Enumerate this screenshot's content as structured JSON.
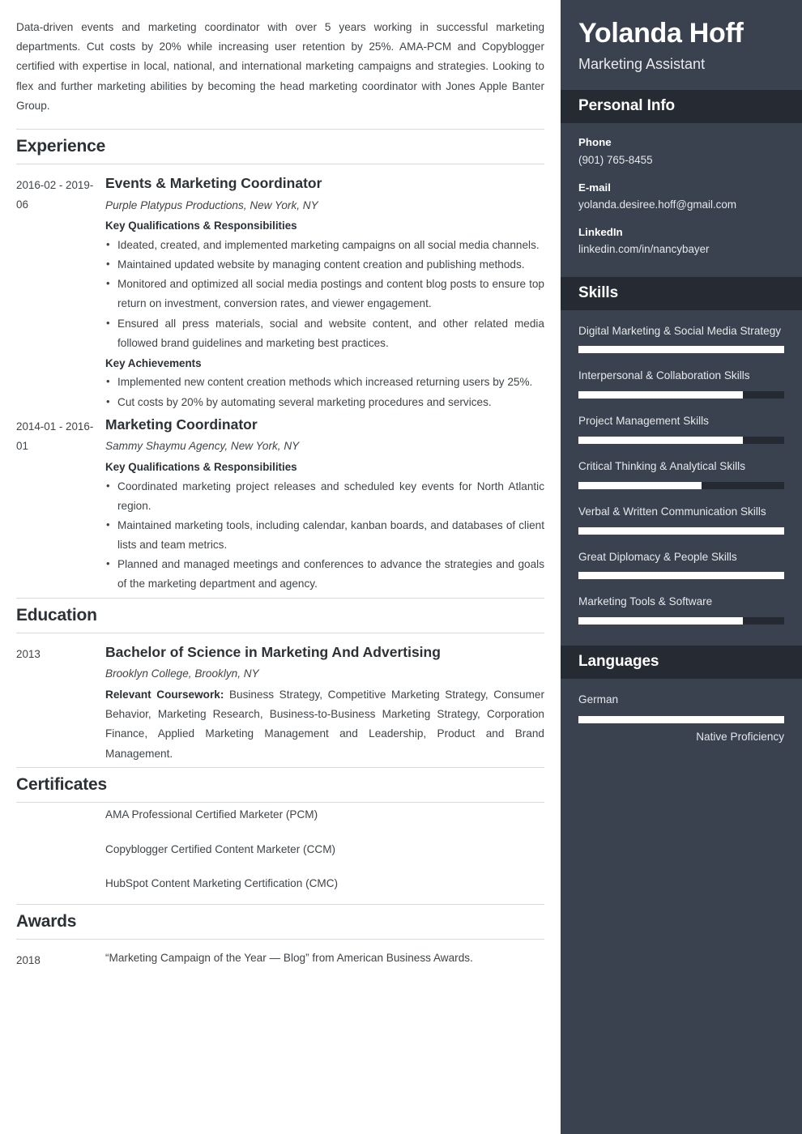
{
  "main": {
    "summary": "Data-driven events and marketing coordinator with over 5 years working in successful marketing departments. Cut costs by 20% while increasing user retention by 25%. AMA-PCM and Copyblogger certified with expertise in local, national, and international marketing campaigns and strategies. Looking to flex and further marketing abilities by becoming the head marketing coordinator with Jones Apple Banter Group.",
    "sections": {
      "experience_title": "Experience",
      "education_title": "Education",
      "certificates_title": "Certificates",
      "awards_title": "Awards"
    },
    "experience": [
      {
        "date": "2016-02 - 2019-06",
        "title": "Events & Marketing Coordinator",
        "org": "Purple Platypus Productions, New York, NY",
        "qual_heading": "Key Qualifications & Responsibilities",
        "qualifications": [
          "Ideated, created, and implemented marketing campaigns on all social media channels.",
          "Maintained updated website by managing content creation and publishing methods.",
          "Monitored and optimized all social media postings and content blog posts to ensure top return on investment, conversion rates, and viewer engagement.",
          "Ensured all press materials, social and website content, and other related media followed brand guidelines and marketing best practices."
        ],
        "achieve_heading": "Key Achievements",
        "achievements": [
          "Implemented new content creation methods which increased returning users by 25%.",
          "Cut costs by 20% by automating several marketing procedures and services."
        ]
      },
      {
        "date": "2014-01 - 2016-01",
        "title": "Marketing Coordinator",
        "org": "Sammy Shaymu Agency, New York, NY",
        "qual_heading": "Key Qualifications & Responsibilities",
        "qualifications": [
          "Coordinated marketing project releases and scheduled key events for North Atlantic region.",
          "Maintained marketing tools, including calendar, kanban boards, and databases of client lists and team metrics.",
          "Planned and managed meetings and conferences to advance the strategies and goals of the marketing department and agency."
        ],
        "achieve_heading": "",
        "achievements": []
      }
    ],
    "education": [
      {
        "date": "2013",
        "title": "Bachelor of Science in Marketing And Advertising",
        "org": "Brooklyn College, Brooklyn, NY",
        "coursework_label": "Relevant Coursework:",
        "coursework": "Business Strategy, Competitive Marketing Strategy, Consumer Behavior, Marketing Research, Business-to-Business Marketing Strategy, Corporation Finance, Applied Marketing Management and Leadership, Product and Brand Management."
      }
    ],
    "certificates": [
      "AMA Professional Certified Marketer (PCM)",
      "Copyblogger Certified Content Marketer (CCM)",
      "HubSpot Content Marketing Certification (CMC)"
    ],
    "awards": [
      {
        "date": "2018",
        "text": "“Marketing Campaign of the Year — Blog” from American Business Awards."
      }
    ]
  },
  "sidebar": {
    "name": "Yolanda Hoff",
    "role": "Marketing Assistant",
    "personal_info": {
      "title": "Personal Info",
      "items": [
        {
          "label": "Phone",
          "value": "(901) 765-8455"
        },
        {
          "label": "E-mail",
          "value": "yolanda.desiree.hoff@gmail.com"
        },
        {
          "label": "LinkedIn",
          "value": "linkedin.com/in/nancybayer"
        }
      ]
    },
    "skills": {
      "title": "Skills",
      "items": [
        {
          "name": "Digital Marketing & Social Media Strategy",
          "level": 100
        },
        {
          "name": "Interpersonal & Collaboration Skills",
          "level": 80
        },
        {
          "name": "Project Management Skills",
          "level": 80
        },
        {
          "name": "Critical Thinking & Analytical Skills",
          "level": 60
        },
        {
          "name": "Verbal & Written Communication Skills",
          "level": 100
        },
        {
          "name": "Great Diplomacy & People Skills",
          "level": 100
        },
        {
          "name": "Marketing Tools & Software",
          "level": 80
        }
      ]
    },
    "languages": {
      "title": "Languages",
      "items": [
        {
          "name": "German",
          "level": 100,
          "proficiency": "Native Proficiency"
        }
      ]
    }
  },
  "colors": {
    "sidebar_bg": "#3a4250",
    "sidebar_band_bg": "#262b33",
    "bar_fill": "#ffffff",
    "bar_track": "#252a32",
    "heading": "#2c3136",
    "body_text": "#3f4448",
    "rule": "#d8dbdd"
  }
}
